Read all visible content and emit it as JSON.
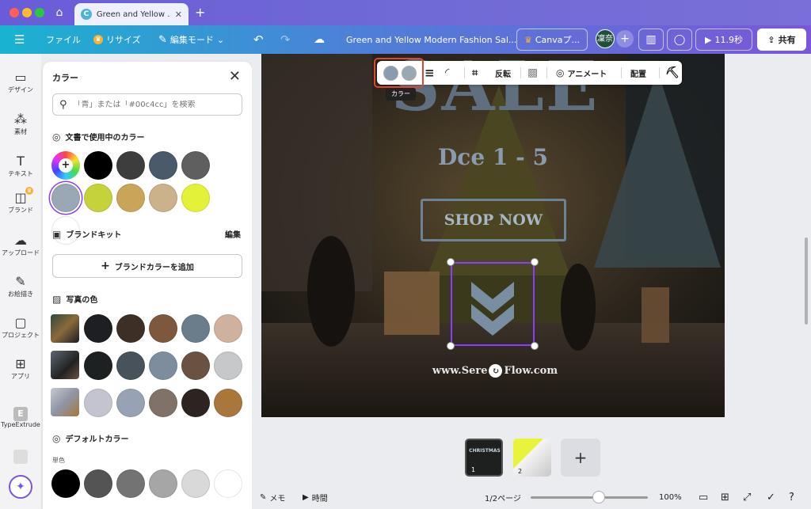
{
  "window": {
    "tab_title": "Green and Yellow ...",
    "tab_favicon": "C"
  },
  "toolbar": {
    "menu_icon": "hamburger-icon",
    "file": "ファイル",
    "resize": "リサイズ",
    "edit_mode": "編集モード",
    "doc_title": "Green and Yellow Modern Fashion Sal...",
    "canva_pro": "Canvaプ...",
    "avatar": "凜奈",
    "timer": "11.9秒",
    "share": "共有"
  },
  "rail": {
    "items": [
      {
        "label": "デザイン",
        "icon": "design-icon"
      },
      {
        "label": "素材",
        "icon": "elements-icon"
      },
      {
        "label": "テキスト",
        "icon": "text-icon"
      },
      {
        "label": "ブランド",
        "icon": "brand-icon"
      },
      {
        "label": "アップロード",
        "icon": "upload-icon"
      },
      {
        "label": "お絵描き",
        "icon": "draw-icon"
      },
      {
        "label": "プロジェクト",
        "icon": "folder-icon"
      },
      {
        "label": "アプリ",
        "icon": "apps-icon"
      },
      {
        "label": "TypeExtrude",
        "icon": "typeextrude-icon"
      }
    ]
  },
  "panel": {
    "title": "カラー",
    "search_placeholder": "「青」または「#00c4cc」を検索",
    "doc_colors_heading": "文書で使用中のカラー",
    "doc_colors": [
      "#000000",
      "#3d3d3d",
      "#4a5a6a",
      "#5f5f5f",
      "#9aa8b6",
      "#c6d23a",
      "#c9a55a",
      "#cbb28a",
      "#e3f238",
      "#ffffff"
    ],
    "brand_kit_heading": "ブランドキット",
    "brand_kit_edit": "編集",
    "add_brand_color": "ブランドカラーを追加",
    "photo_colors_heading": "写真の色",
    "photo_row1": [
      "#1d1f22",
      "#3e2f26",
      "#7d583c",
      "#6b7d8a",
      "#cfb19c"
    ],
    "photo_row2": [
      "#1e2121",
      "#47525a",
      "#7d8d9e",
      "#6a5242",
      "#c6c8c9"
    ],
    "photo_row3": [
      "#c3c4cf",
      "#97a2b4",
      "#807268",
      "#2d2422",
      "#a9773c"
    ],
    "default_colors_heading": "デフォルトカラー",
    "solid_label": "単色",
    "default_colors": [
      "#000000",
      "#545454",
      "#737373",
      "#a6a6a6",
      "#d9d9d9",
      "#ffffff"
    ]
  },
  "canvas": {
    "headline": "SALE",
    "date": "Dce 1 - 5",
    "cta": "SHOP NOW",
    "url_part1": "www.Sere",
    "url_part2": "Flow.com"
  },
  "floating_toolbar": {
    "flip": "反転",
    "animate": "アニメート",
    "position": "配置",
    "tooltip": "カラー"
  },
  "pages": {
    "thumb1_label": "1",
    "thumb2_label": "2",
    "thumb1_text": "CHRISTMAS"
  },
  "status": {
    "notes": "メモ",
    "timing": "時間",
    "page_indicator": "1/2ページ",
    "zoom": "100%"
  }
}
